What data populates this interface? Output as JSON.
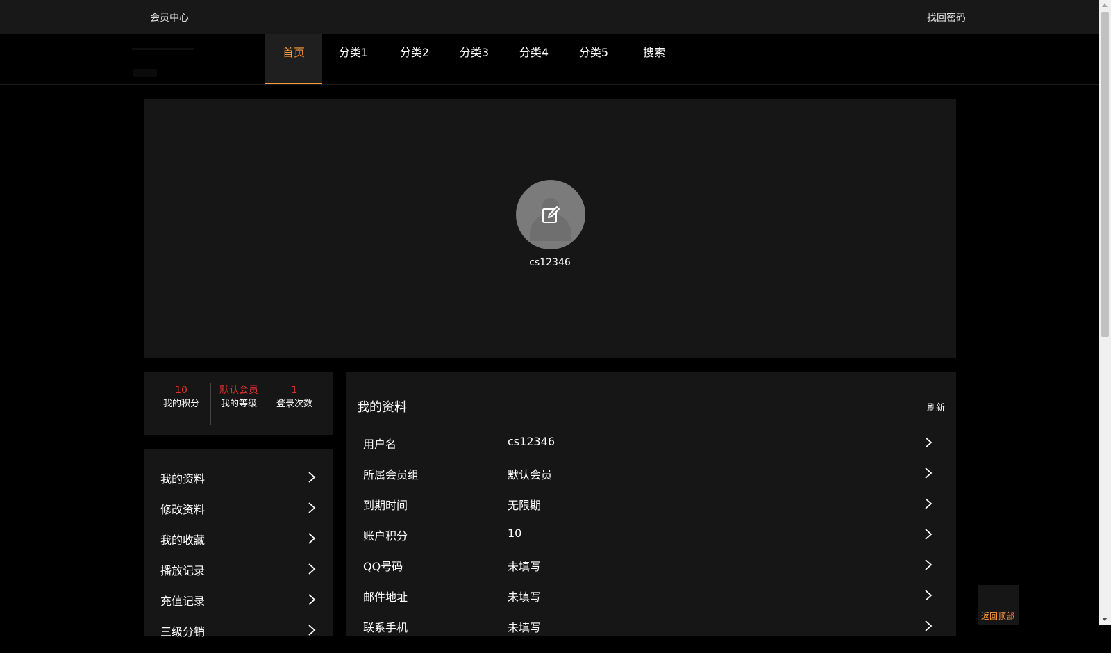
{
  "topbar": {
    "member_center": "会员中心",
    "find_password": "找回密码"
  },
  "nav": {
    "items": [
      "首页",
      "分类1",
      "分类2",
      "分类3",
      "分类4",
      "分类5",
      "搜索"
    ],
    "active_index": 0
  },
  "profile": {
    "username": "cs12346"
  },
  "stats": [
    {
      "value": "10",
      "label": "我的积分"
    },
    {
      "value": "默认会员",
      "label": "我的等级"
    },
    {
      "value": "1",
      "label": "登录次数"
    }
  ],
  "menu": {
    "items": [
      "我的资料",
      "修改资料",
      "我的收藏",
      "播放记录",
      "充值记录",
      "三级分销"
    ]
  },
  "info": {
    "title": "我的资料",
    "refresh": "刷新",
    "rows": [
      {
        "key": "用户名",
        "value": "cs12346"
      },
      {
        "key": "所属会员组",
        "value": "默认会员"
      },
      {
        "key": "到期时间",
        "value": "无限期"
      },
      {
        "key": "账户积分",
        "value": "10"
      },
      {
        "key": "QQ号码",
        "value": "未填写"
      },
      {
        "key": "邮件地址",
        "value": "未填写"
      },
      {
        "key": "联系手机",
        "value": "未填写"
      }
    ]
  },
  "back_to_top": "返回顶部",
  "colors": {
    "accent": "#ff9a3c",
    "highlight": "#e13232",
    "panel": "#161616"
  },
  "icons": [
    "edit-icon",
    "chevron-right-icon"
  ]
}
